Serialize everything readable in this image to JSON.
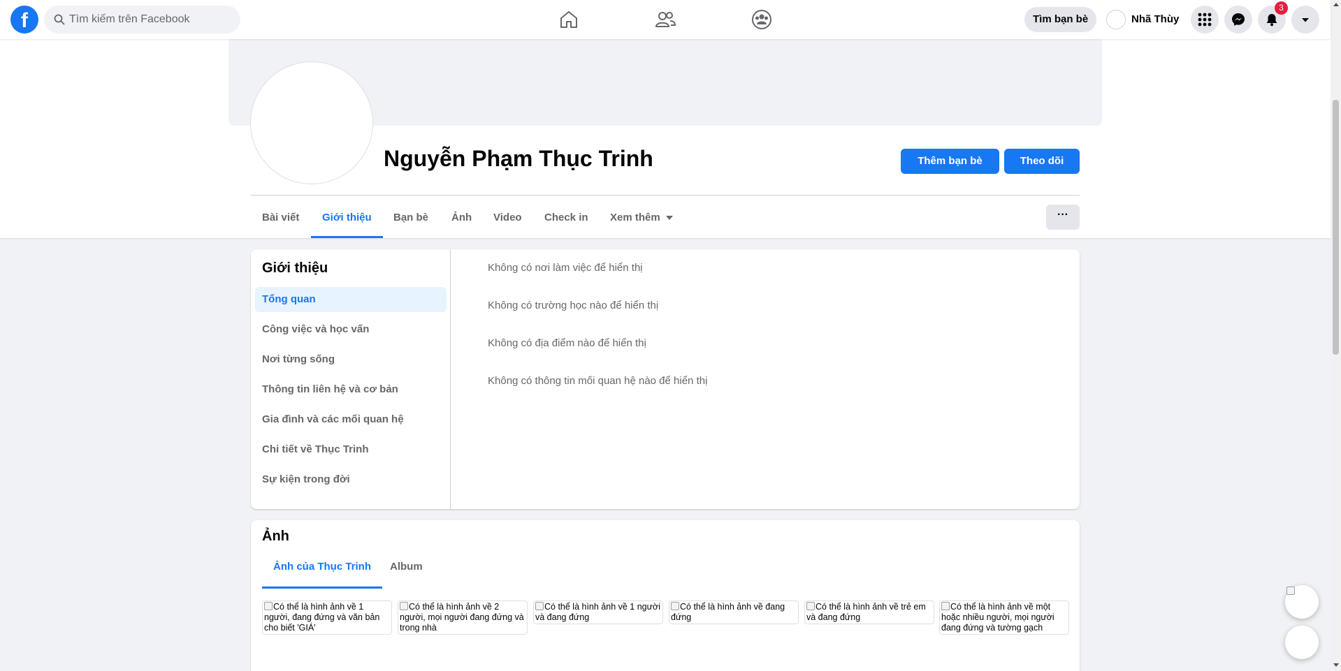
{
  "topbar": {
    "logo": "f",
    "search_placeholder": "Tìm kiếm trên Facebook",
    "find_friends_label": "Tìm bạn bè",
    "user_name": "Nhã Thùy",
    "notifications_count": "3",
    "icons": [
      "home-icon",
      "friends-icon",
      "groups-icon",
      "menu-grid-icon",
      "messenger-icon",
      "bell-icon",
      "account-caret-icon"
    ]
  },
  "profile": {
    "name": "Nguyễn Phạm Thục Trinh",
    "add_friend_label": "Thêm bạn bè",
    "follow_label": "Theo dõi",
    "more_label": "···"
  },
  "tabs": [
    {
      "label": "Bài viết",
      "active": false
    },
    {
      "label": "Giới thiệu",
      "active": true
    },
    {
      "label": "Bạn bè",
      "active": false
    },
    {
      "label": "Ảnh",
      "active": false
    },
    {
      "label": "Video",
      "active": false
    },
    {
      "label": "Check in",
      "active": false
    },
    {
      "label": "Xem thêm",
      "active": false
    }
  ],
  "about": {
    "title": "Giới thiệu",
    "items": [
      {
        "label": "Tổng quan",
        "active": true
      },
      {
        "label": "Công việc và học vấn",
        "active": false
      },
      {
        "label": "Nơi từng sống",
        "active": false
      },
      {
        "label": "Thông tin liên hệ và cơ bản",
        "active": false
      },
      {
        "label": "Gia đình và các mối quan hệ",
        "active": false
      },
      {
        "label": "Chi tiết về Thục Trinh",
        "active": false
      },
      {
        "label": "Sự kiện trong đời",
        "active": false
      }
    ],
    "lines": [
      "Không có nơi làm việc để hiển thị",
      "Không có trường học nào để hiển thị",
      "Không có địa điểm nào để hiển thị",
      "Không có thông tin mối quan hệ nào để hiển thị"
    ]
  },
  "photos": {
    "title": "Ảnh",
    "tabs": [
      {
        "label": "Ảnh của Thục Trinh",
        "active": true
      },
      {
        "label": "Album",
        "active": false
      }
    ],
    "tiles": [
      "Có thể là hình ảnh về 1 người, đang đứng và văn bản cho biết 'GIÁ'",
      "Có thể là hình ảnh về 2 người, mọi người đang đứng và trong nhà",
      "Có thể là hình ảnh về 1 người và đang đứng",
      "Có thể là hình ảnh về đang đứng",
      "Có thể là hình ảnh về trẻ em và đang đứng",
      "Có thể là hình ảnh về một hoặc nhiều người, mọi người đang đứng và tường gạch"
    ]
  },
  "colors": {
    "accent": "#1877f2",
    "background": "#f0f2f5",
    "badge": "#e41e3f",
    "secondary_text": "#65676b"
  }
}
